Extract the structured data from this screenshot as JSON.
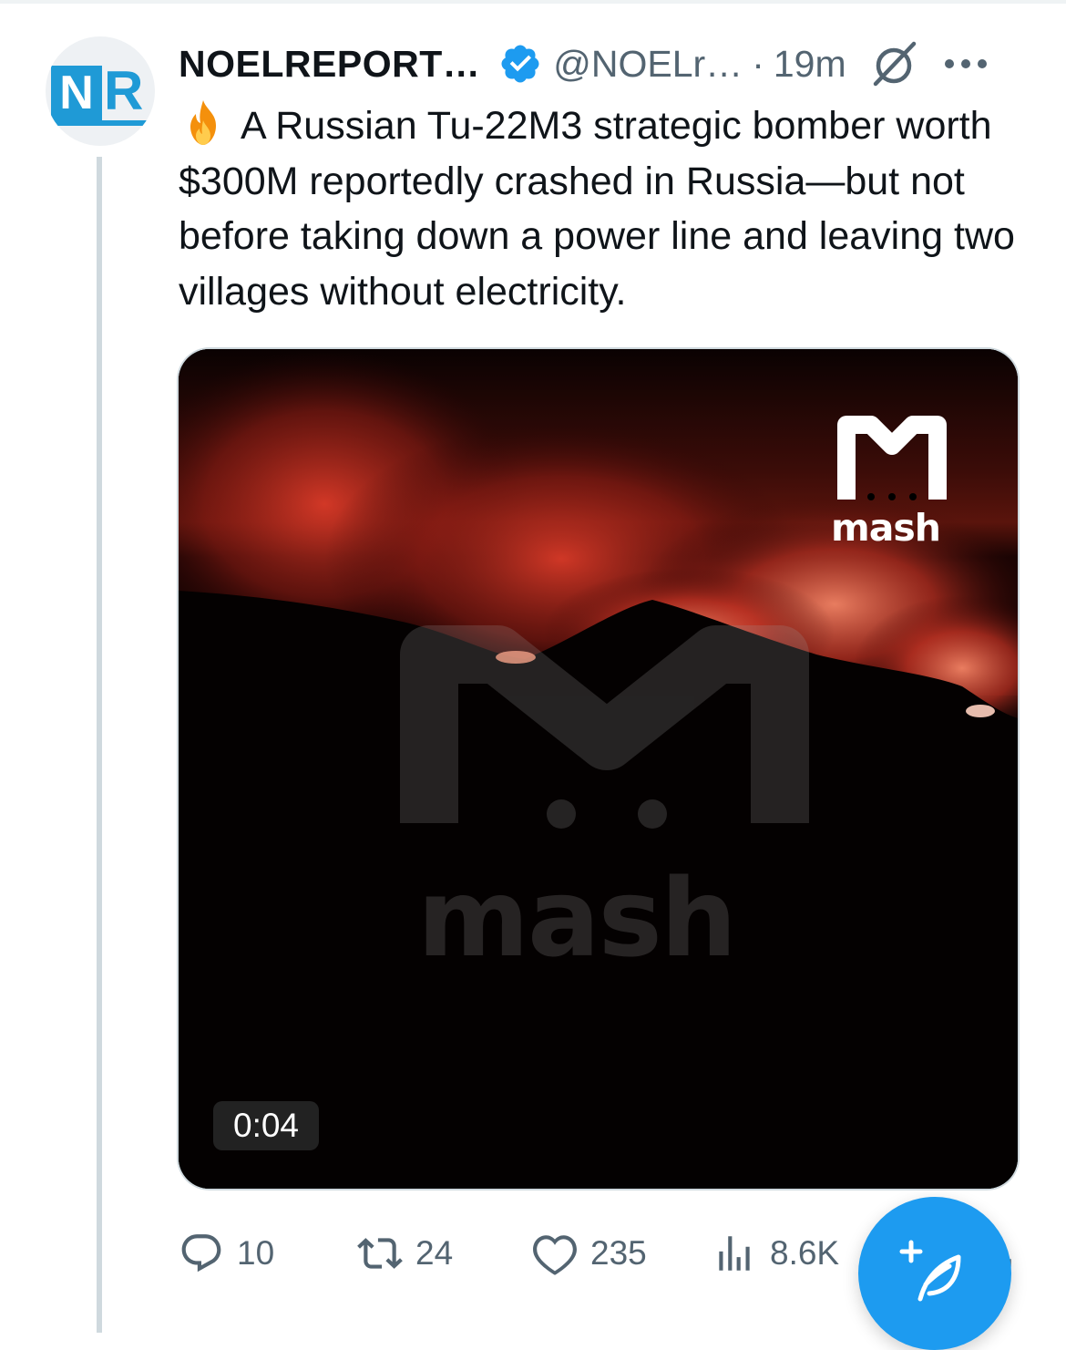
{
  "tweet": {
    "author": {
      "display_name": "NOELREPORT…",
      "handle": "@NOELr…",
      "verified": true,
      "avatar_text": {
        "first": "N",
        "second": "R"
      }
    },
    "separator": "·",
    "time": "19m",
    "text": "A Russian Tu-22M3 strategic bomber worth $300M reportedly crashed in Russia—but not before taking down a power line and leaving two villages without electricity.",
    "leading_emoji": "fire-icon",
    "media": {
      "type": "video",
      "duration": "0:04",
      "watermark_small": "mash",
      "watermark_large": "mash"
    },
    "actions": {
      "reply_count": "10",
      "retweet_count": "24",
      "like_count": "235",
      "views_count": "8.6K"
    }
  },
  "icons": {
    "verified": "verified-badge-icon",
    "grok": "grok-icon",
    "more": "more-options-icon",
    "reply": "reply-icon",
    "retweet": "retweet-icon",
    "like": "heart-icon",
    "views": "views-icon",
    "share": "share-icon",
    "compose": "compose-tweet-icon"
  },
  "colors": {
    "accent": "#1d9bf0",
    "secondary_text": "#536471",
    "primary_text": "#0f1419",
    "thread_line": "#cfd9de",
    "avatar_brand": "#1f9ad6"
  }
}
